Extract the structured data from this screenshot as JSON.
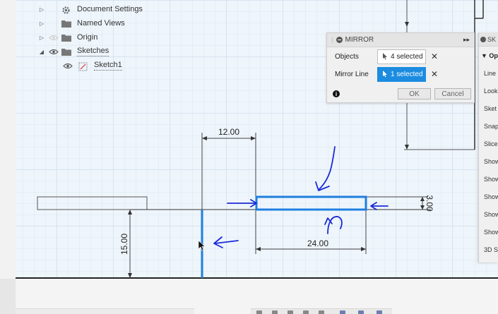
{
  "browser": {
    "items": [
      {
        "label": "Document Settings",
        "icon": "gear-icon"
      },
      {
        "label": "Named Views",
        "icon": "folder-icon"
      },
      {
        "label": "Origin",
        "icon": "folder-icon"
      },
      {
        "label": "Sketches",
        "icon": "folder-icon"
      },
      {
        "label": "Sketch1",
        "icon": "sketch-icon"
      }
    ]
  },
  "mirror": {
    "title": "MIRROR",
    "objects_label": "Objects",
    "objects_value": "4 selected",
    "mirror_line_label": "Mirror Line",
    "mirror_line_value": "1 selected",
    "ok_label": "OK",
    "cancel_label": "Cancel",
    "info_glyph": "i"
  },
  "palette": {
    "title": "SK",
    "options_label": "Opt",
    "items": [
      "Line",
      "Look",
      "Sket",
      "Snap",
      "Slice",
      "Show",
      "Show",
      "Show",
      "Show",
      "Show",
      "3D S"
    ]
  },
  "sketch": {
    "dimensions": {
      "top_width": "12.00",
      "bottom_width": "24.00",
      "height_left": "15.00",
      "height_right": "3.00"
    }
  },
  "colors": {
    "selection": "#1e7fe0",
    "annotation": "#1a2ad8",
    "accent_button": "#1b8ce0"
  }
}
